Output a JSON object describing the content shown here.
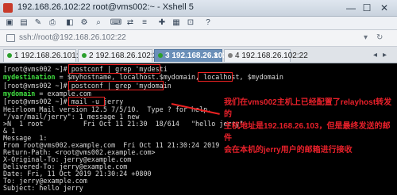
{
  "window": {
    "title": "192.168.26.102:22   root@vms002:~ - Xshell 5",
    "minimize": "—",
    "maximize": "☐",
    "close": "✕"
  },
  "menubar": {
    "icons": [
      "folder-icon",
      "save-icon",
      "edit-icon",
      "print-icon",
      "view-icon",
      "settings-icon",
      "find-icon",
      "keyboard-icon",
      "transfer-icon",
      "script-icon",
      "tools-icon",
      "window-icon",
      "lock-icon",
      "help-icon"
    ]
  },
  "address": {
    "value": "ssh://root@192.168.26.102:22"
  },
  "tabs": [
    {
      "label": "1 192.168.26.101:22",
      "dot": "#2ca02c"
    },
    {
      "label": "2 192.168.26.102:22",
      "dot": "#2ca02c"
    },
    {
      "label": "3 192.168.26.102:22",
      "dot": "#2ca02c"
    },
    {
      "label": "4 192.168.26.102:22",
      "dot": "#7f7f7f"
    }
  ],
  "terminal": {
    "l1_prompt": "[root@vms002 ~]# ",
    "l1_cmd": "postconf | grep 'mydesti",
    "l2_key": "mydestination",
    "l2_val": " = $myhostname, localhost.$mydomain, localhost, ",
    "l2_box": "$mydomain",
    "l3_prompt": "[root@vms002 ~]# ",
    "l3_cmd": "postconf | grep 'mydomain",
    "l4_key": "mydomain",
    "l4_val": " = example.com",
    "l5": "[root@vms002 ~]# mail -u jerry",
    "l6": "Heirloom Mail version 12.5 7/5/10.  Type ? for help.",
    "l7": "\"/var/mail/jerry\": 1 message 1 new",
    "l8": ">N  1 root          Fri Oct 11 21:30  18/614   \"hello jerry\"",
    "l9": "& 1",
    "l10": "Message  1:",
    "l11": "From root@vms002.example.com  Fri Oct 11 21:30:24 2019",
    "l12": "Return-Path: <root@vms002.example.com>",
    "l13": "X-Original-To: jerry@example.com",
    "l14": "Delivered-To: jerry@example.com",
    "l15": "Date: Fri, 11 Oct 2019 21:30:24 +0800",
    "l16": "To: jerry@example.com",
    "l17": "Subject: hello jerry"
  },
  "annotation": {
    "line1": "我们在vms002主机上已经配置了relayhost转发的",
    "line2": "主机地址是192.168.26.103，但是最终发送的邮件",
    "line3": "会在本机的jerry用户的邮箱进行接收"
  }
}
